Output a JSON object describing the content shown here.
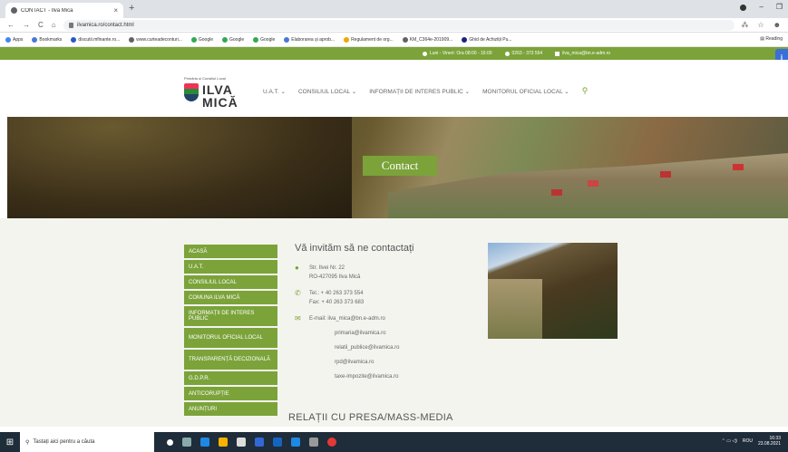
{
  "browser": {
    "tab_title": "CONTACT - Ilva Mică",
    "url": "ilvamica.ro/contact.html",
    "reading": "Reading"
  },
  "bookmarks": [
    {
      "label": "Apps",
      "color": "#4285f4"
    },
    {
      "label": "Bookmarks",
      "color": "#4a77d4"
    },
    {
      "label": "discutii.mfinante.ro...",
      "color": "#2a56c6"
    },
    {
      "label": "www.curteadeconturi...",
      "color": "#5f6368"
    },
    {
      "label": "Google",
      "color": "#34a853"
    },
    {
      "label": "Google",
      "color": "#34a853"
    },
    {
      "label": "Google",
      "color": "#34a853"
    },
    {
      "label": "Elaborarea și aprob...",
      "color": "#4a77d4"
    },
    {
      "label": "Regulament de org...",
      "color": "#f0a800"
    },
    {
      "label": "KM_C364e-201909...",
      "color": "#5f6368"
    },
    {
      "label": "Ghid de Achiziții Pu...",
      "color": "#1a237e"
    }
  ],
  "infobar": {
    "hours": "Luni - Vineri: Ora 08:00 - 16:00",
    "phone": "0263 - 373 554",
    "email": "ilva_mica@bn.e-adm.ro"
  },
  "logo": {
    "subtitle": "Primăria și Consiliul Local",
    "name_line1": "ILVA",
    "name_line2": "MICĂ"
  },
  "nav": {
    "items": [
      "U.A.T.",
      "CONSILIUL LOCAL",
      "INFORMAȚII DE INTERES PUBLIC",
      "MONITORUL OFICIAL LOCAL"
    ],
    "search_icon": "search-icon"
  },
  "banner": {
    "title": "Contact"
  },
  "sidebar": {
    "items": [
      {
        "label": "ACASĂ",
        "h": 15
      },
      {
        "label": "U.A.T.",
        "h": 15
      },
      {
        "label": "CONSILIUL LOCAL",
        "h": 15
      },
      {
        "label": "COMUNA ILVA MICĂ",
        "h": 15
      },
      {
        "label": "INFORMAȚII DE INTERES PUBLIC",
        "h": 22
      },
      {
        "label": "MONITORUL OFICIAL LOCAL",
        "h": 22
      },
      {
        "label": "TRANSPARENȚĂ DECIZIONALĂ",
        "h": 22
      },
      {
        "label": "G.D.P.R.",
        "h": 15
      },
      {
        "label": "ANTICORUPȚIE",
        "h": 15
      },
      {
        "label": "ANUNȚURI",
        "h": 15
      }
    ]
  },
  "contact": {
    "heading": "Vă invităm să ne contactați",
    "address_line1": "Str. Ilvei Nr. 22",
    "address_line2": "RO-427095 Ilva Mică",
    "tel": "Tel.: + 40 263 373 554",
    "fax": "Fax: + 40 263 373 683",
    "email": "E-mail: ilva_mica@bn.e-adm.ro",
    "email_list": [
      "primaria@ilvamica.ro",
      "relatii_publice@ilvamica.ro",
      "rpd@ilvamica.ro",
      "taxe-impozite@ilvamica.ro"
    ]
  },
  "press": {
    "heading": "RELAȚII CU PRESA/MASS-MEDIA"
  },
  "taskbar": {
    "search_placeholder": "Tastați aici pentru a căuta",
    "lang": "ROU",
    "time": "16:33",
    "date": "23.08.2021"
  }
}
